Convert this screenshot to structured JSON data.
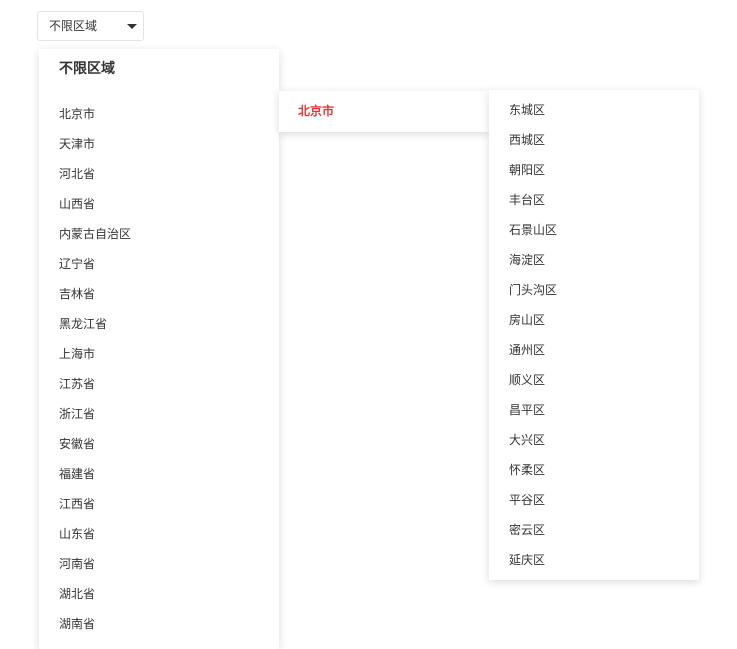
{
  "selector": {
    "label": "不限区域"
  },
  "province_panel": {
    "any_region_label": "不限区域",
    "items": [
      "北京市",
      "天津市",
      "河北省",
      "山西省",
      "内蒙古自治区",
      "辽宁省",
      "吉林省",
      "黑龙江省",
      "上海市",
      "江苏省",
      "浙江省",
      "安徽省",
      "福建省",
      "江西省",
      "山东省",
      "河南省",
      "湖北省",
      "湖南省"
    ]
  },
  "city_panel": {
    "selected_city": "北京市"
  },
  "district_panel": {
    "items": [
      "东城区",
      "西城区",
      "朝阳区",
      "丰台区",
      "石景山区",
      "海淀区",
      "门头沟区",
      "房山区",
      "通州区",
      "顺义区",
      "昌平区",
      "大兴区",
      "怀柔区",
      "平谷区",
      "密云区",
      "延庆区"
    ]
  },
  "colors": {
    "accent": "#e4393c",
    "text": "#333333",
    "border": "#e3e3e3"
  },
  "icons": {
    "dropdown": "caret-down-icon"
  }
}
